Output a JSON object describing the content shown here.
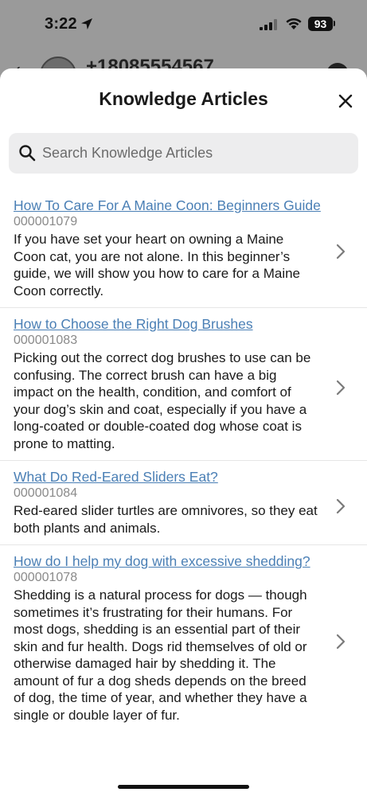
{
  "status_bar": {
    "time": "3:22",
    "battery": "93",
    "location_icon": "location-arrow-icon",
    "signal_icon": "cellular-signal-icon",
    "wifi_icon": "wifi-icon"
  },
  "background_screen": {
    "back_icon": "chevron-left-icon",
    "phone_number": "+18085554567"
  },
  "sheet": {
    "title": "Knowledge Articles",
    "close_icon": "close-icon",
    "search": {
      "placeholder": "Search Knowledge Articles",
      "value": "",
      "icon": "search-icon"
    },
    "articles": [
      {
        "title": "How To Care For A Maine Coon: Beginners Guide",
        "number": "000001079",
        "summary": "If you have set your heart on owning a Maine Coon cat, you are not alone. In this beginner’s guide, we will show you how to care for a Maine Coon correctly."
      },
      {
        "title": "How to Choose the Right Dog Brushes",
        "number": "000001083",
        "summary": "Picking out the correct dog brushes to use can be confusing. The correct brush can have a big impact on the health, condition, and comfort of your dog’s skin and coat, especially if you have a long-coated or double-coated dog whose coat is prone to matting."
      },
      {
        "title": "What Do Red-Eared Sliders Eat?",
        "number": "000001084",
        "summary": "Red-eared slider turtles are omnivores, so they eat both plants and animals."
      },
      {
        "title": "How do I help my dog with excessive shedding?",
        "number": "000001078",
        "summary": "Shedding is a natural process for dogs — though sometimes it’s frustrating for their humans. For most dogs, shedding is an essential part of their skin and fur health. Dogs rid themselves of old or otherwise damaged hair by shedding it. The amount of fur a dog sheds depends on the breed of dog, the time of year, and whether they have a single or double layer of fur."
      }
    ]
  },
  "colors": {
    "link": "#4a7fb5",
    "article_number": "#8a8a8a",
    "search_background": "#ededee",
    "backdrop": "#9a9a9a"
  }
}
